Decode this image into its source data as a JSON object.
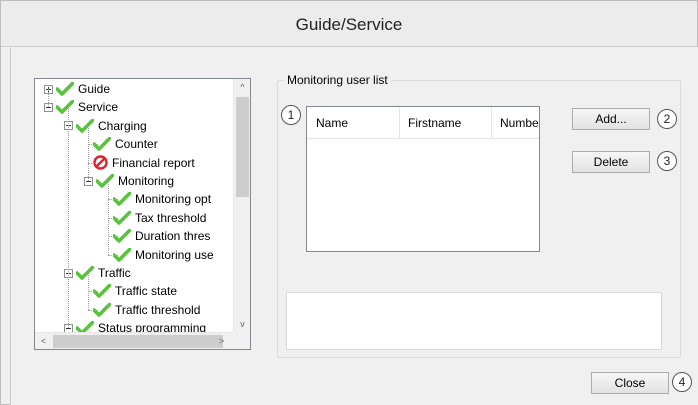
{
  "window": {
    "title": "Guide/Service"
  },
  "tree": {
    "items": [
      {
        "label": "Guide",
        "level": 0,
        "expander": "plus",
        "icon": "check-icon"
      },
      {
        "label": "Service",
        "level": 0,
        "expander": "minus",
        "icon": "check-icon"
      },
      {
        "label": "Charging",
        "level": 1,
        "expander": "minus",
        "icon": "check-icon"
      },
      {
        "label": "Counter",
        "level": 2,
        "expander": "none",
        "icon": "check-icon"
      },
      {
        "label": "Financial report",
        "level": 2,
        "expander": "none",
        "icon": "no-entry-icon"
      },
      {
        "label": "Monitoring",
        "level": 2,
        "expander": "minus",
        "icon": "check-icon"
      },
      {
        "label": "Monitoring opt",
        "level": 3,
        "expander": "none",
        "icon": "check-icon"
      },
      {
        "label": "Tax threshold",
        "level": 3,
        "expander": "none",
        "icon": "check-icon"
      },
      {
        "label": "Duration thres",
        "level": 3,
        "expander": "none",
        "icon": "check-icon"
      },
      {
        "label": "Monitoring use",
        "level": 3,
        "expander": "none",
        "icon": "check-icon"
      },
      {
        "label": "Traffic",
        "level": 1,
        "expander": "minus",
        "icon": "check-icon"
      },
      {
        "label": "Traffic state",
        "level": 2,
        "expander": "none",
        "icon": "check-icon"
      },
      {
        "label": "Traffic threshold",
        "level": 2,
        "expander": "none",
        "icon": "check-icon"
      },
      {
        "label": "Status programming",
        "level": 1,
        "expander": "minus",
        "icon": "check-icon"
      }
    ],
    "scroll_up": "^",
    "scroll_down": "v",
    "scroll_left": "<",
    "scroll_right": ">"
  },
  "monitoring": {
    "group_label": "Monitoring user list",
    "columns": [
      "Name",
      "Firstname",
      "Numbe"
    ],
    "rows": [],
    "add_label": "Add...",
    "delete_label": "Delete",
    "memo_text": ""
  },
  "close_label": "Close",
  "callouts": [
    "1",
    "2",
    "3",
    "4"
  ],
  "colors": {
    "check": "#58c33c",
    "no_entry": "#e0202a"
  }
}
